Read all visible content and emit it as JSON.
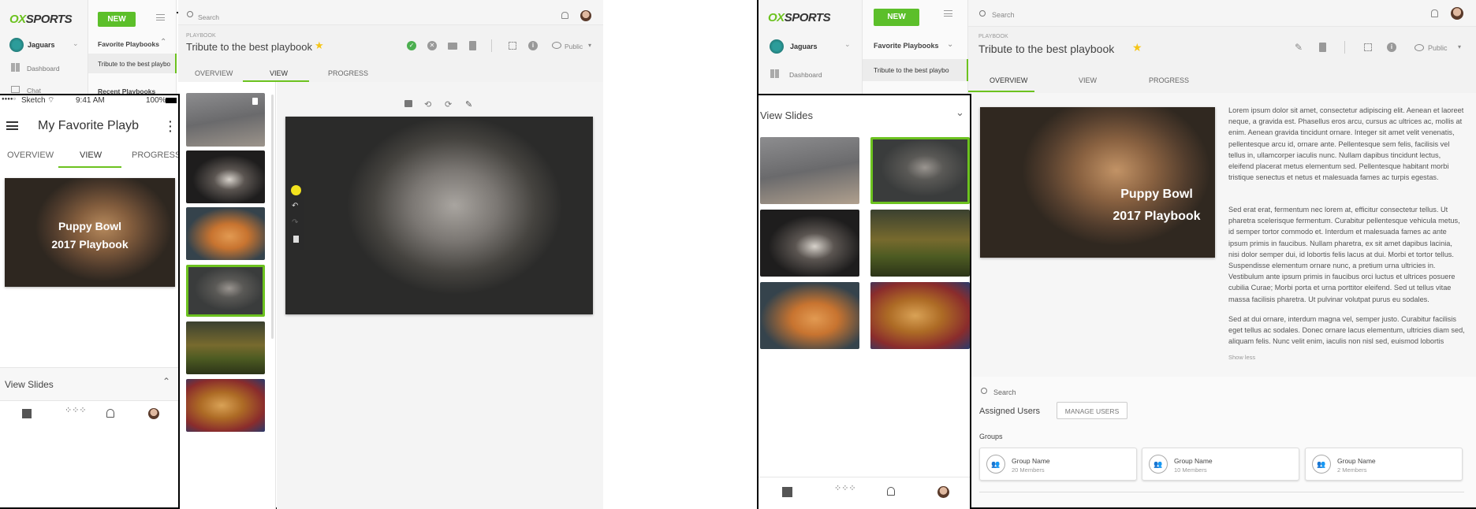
{
  "desktop": {
    "brand": {
      "logo_x": "OX",
      "logo_rest": "SPORTS"
    },
    "new_button": "NEW",
    "team": "Jaguars",
    "nav": {
      "dashboard": "Dashboard",
      "chat": "Chat"
    },
    "favorites": {
      "header": "Favorite Playbooks",
      "item": "Tribute to the best playbo",
      "recent": "Recent Playbooks"
    },
    "search_placeholder": "Search",
    "breadcrumb": "PLAYBOOK",
    "title": "Tribute to the best playbook",
    "visibility": "Public",
    "tabs": [
      "OVERVIEW",
      "VIEW",
      "PROGRESS"
    ],
    "active_tab": "VIEW"
  },
  "mobile": {
    "status": {
      "carrier": "Sketch",
      "time": "9:41 AM",
      "battery": "100%"
    },
    "title": "My Favorite Playb",
    "tabs": [
      "OVERVIEW",
      "VIEW",
      "PROGRESS"
    ],
    "hero": {
      "line1": "Puppy Bowl",
      "line2": "2017 Playbook"
    },
    "view_slides": "View Slides"
  },
  "right": {
    "brand": {
      "logo_x": "OX",
      "logo_rest": "SPORTS"
    },
    "new_button": "NEW",
    "team": "Jaguars",
    "nav": {
      "dashboard": "Dashboard"
    },
    "favorites": {
      "header": "Favorite Playbooks",
      "item": "Tribute to the best playbo"
    },
    "search_placeholder": "Search",
    "breadcrumb": "PLAYBOOK",
    "title": "Tribute to the best playbook",
    "visibility": "Public",
    "tabs": [
      "OVERVIEW",
      "VIEW",
      "PROGRESS"
    ],
    "active_tab": "OVERVIEW",
    "view_slides": "View Slides",
    "hero": {
      "line1": "Puppy Bowl",
      "line2": "2017 Playbook"
    },
    "description": [
      "Lorem ipsum dolor sit amet, consectetur adipiscing elit. Aenean et laoreet neque, a gravida est. Phasellus eros arcu, cursus ac ultrices ac, mollis at enim. Aenean gravida tincidunt ornare. Integer sit amet velit venenatis, pellentesque arcu id, ornare ante. Pellentesque sem felis, facilisis vel tellus in, ullamcorper iaculis nunc. Nullam dapibus tincidunt lectus, eleifend placerat metus elementum sed. Pellentesque habitant morbi tristique senectus et netus et malesuada fames ac turpis egestas.",
      "Sed erat erat, fermentum nec lorem at, efficitur consectetur tellus. Ut pharetra scelerisque fermentum. Curabitur pellentesque vehicula metus, id semper tortor commodo et. Interdum et malesuada fames ac ante ipsum primis in faucibus. Nullam pharetra, ex sit amet dapibus lacinia, nisi dolor semper dui, id lobortis felis lacus at dui. Morbi et tortor tellus. Suspendisse elementum ornare nunc, a pretium urna ultricies in. Vestibulum ante ipsum primis in faucibus orci luctus et ultrices posuere cubilia Curae; Morbi porta et urna porttitor eleifend. Sed ut tellus vitae massa facilisis pharetra. Ut pulvinar volutpat purus eu sodales.",
      "Sed at dui ornare, interdum magna vel, semper justo. Curabitur facilisis eget tellus ac sodales. Donec ornare lacus elementum, ultricies diam sed, aliquam felis. Nunc velit enim, iaculis non nisl sed, euismod lobortis"
    ],
    "show_less": "Show less",
    "users_search": "Search",
    "assigned_users": "Assigned Users",
    "manage_users": "MANAGE USERS",
    "groups_label": "Groups",
    "groups": [
      {
        "name": "Group Name",
        "members": "20 Members"
      },
      {
        "name": "Group Name",
        "members": "10 Members"
      },
      {
        "name": "Group Name",
        "members": "2 Members"
      }
    ]
  },
  "colors": {
    "accent": "#6cc21f",
    "star": "#f5c518",
    "ok": "#4caf50"
  }
}
